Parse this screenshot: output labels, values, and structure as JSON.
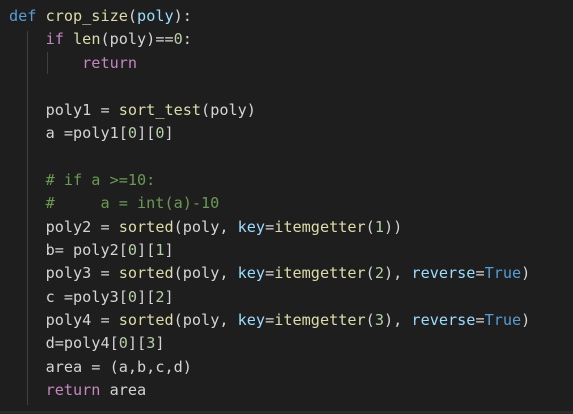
{
  "colors": {
    "background": "#1e1e1e",
    "default_text": "#d4d4d4",
    "keyword": "#569cd6",
    "control_keyword": "#c586c0",
    "function": "#dcdcaa",
    "parameter": "#9cdcfe",
    "number": "#b5cea8",
    "comment": "#6a9955"
  },
  "code": {
    "lines": [
      [
        {
          "t": "def",
          "c": "kw"
        },
        {
          "t": " ",
          "c": "plain"
        },
        {
          "t": "crop_size",
          "c": "fn"
        },
        {
          "t": "(",
          "c": "plain"
        },
        {
          "t": "poly",
          "c": "var"
        },
        {
          "t": "):",
          "c": "plain"
        }
      ],
      [
        {
          "t": "    ",
          "c": "plain"
        },
        {
          "t": "if",
          "c": "ctrl"
        },
        {
          "t": " ",
          "c": "plain"
        },
        {
          "t": "len",
          "c": "fn"
        },
        {
          "t": "(poly)",
          "c": "plain"
        },
        {
          "t": "==",
          "c": "op"
        },
        {
          "t": "0",
          "c": "num"
        },
        {
          "t": ":",
          "c": "plain"
        }
      ],
      [
        {
          "t": "        ",
          "c": "plain"
        },
        {
          "t": "return",
          "c": "ctrl"
        }
      ],
      [],
      [
        {
          "t": "    poly1 ",
          "c": "plain"
        },
        {
          "t": "=",
          "c": "op"
        },
        {
          "t": " ",
          "c": "plain"
        },
        {
          "t": "sort_test",
          "c": "fn"
        },
        {
          "t": "(poly)",
          "c": "plain"
        }
      ],
      [
        {
          "t": "    a ",
          "c": "plain"
        },
        {
          "t": "=",
          "c": "op"
        },
        {
          "t": "poly1[",
          "c": "plain"
        },
        {
          "t": "0",
          "c": "num"
        },
        {
          "t": "][",
          "c": "plain"
        },
        {
          "t": "0",
          "c": "num"
        },
        {
          "t": "]",
          "c": "plain"
        }
      ],
      [],
      [
        {
          "t": "    ",
          "c": "plain"
        },
        {
          "t": "# if a >=10:",
          "c": "comment"
        }
      ],
      [
        {
          "t": "    ",
          "c": "plain"
        },
        {
          "t": "#     a = int(a)-10",
          "c": "comment"
        }
      ],
      [
        {
          "t": "    poly2 ",
          "c": "plain"
        },
        {
          "t": "=",
          "c": "op"
        },
        {
          "t": " ",
          "c": "plain"
        },
        {
          "t": "sorted",
          "c": "fn"
        },
        {
          "t": "(poly, ",
          "c": "plain"
        },
        {
          "t": "key",
          "c": "var"
        },
        {
          "t": "=",
          "c": "op"
        },
        {
          "t": "itemgetter",
          "c": "fn"
        },
        {
          "t": "(",
          "c": "plain"
        },
        {
          "t": "1",
          "c": "num"
        },
        {
          "t": "))",
          "c": "plain"
        }
      ],
      [
        {
          "t": "    b",
          "c": "plain"
        },
        {
          "t": "=",
          "c": "op"
        },
        {
          "t": " poly2[",
          "c": "plain"
        },
        {
          "t": "0",
          "c": "num"
        },
        {
          "t": "][",
          "c": "plain"
        },
        {
          "t": "1",
          "c": "num"
        },
        {
          "t": "]",
          "c": "plain"
        }
      ],
      [
        {
          "t": "    poly3 ",
          "c": "plain"
        },
        {
          "t": "=",
          "c": "op"
        },
        {
          "t": " ",
          "c": "plain"
        },
        {
          "t": "sorted",
          "c": "fn"
        },
        {
          "t": "(poly, ",
          "c": "plain"
        },
        {
          "t": "key",
          "c": "var"
        },
        {
          "t": "=",
          "c": "op"
        },
        {
          "t": "itemgetter",
          "c": "fn"
        },
        {
          "t": "(",
          "c": "plain"
        },
        {
          "t": "2",
          "c": "num"
        },
        {
          "t": "), ",
          "c": "plain"
        },
        {
          "t": "reverse",
          "c": "var"
        },
        {
          "t": "=",
          "c": "op"
        },
        {
          "t": "True",
          "c": "kw"
        },
        {
          "t": ")",
          "c": "plain"
        }
      ],
      [
        {
          "t": "    c ",
          "c": "plain"
        },
        {
          "t": "=",
          "c": "op"
        },
        {
          "t": "poly3[",
          "c": "plain"
        },
        {
          "t": "0",
          "c": "num"
        },
        {
          "t": "][",
          "c": "plain"
        },
        {
          "t": "2",
          "c": "num"
        },
        {
          "t": "]",
          "c": "plain"
        }
      ],
      [
        {
          "t": "    poly4 ",
          "c": "plain"
        },
        {
          "t": "=",
          "c": "op"
        },
        {
          "t": " ",
          "c": "plain"
        },
        {
          "t": "sorted",
          "c": "fn"
        },
        {
          "t": "(poly, ",
          "c": "plain"
        },
        {
          "t": "key",
          "c": "var"
        },
        {
          "t": "=",
          "c": "op"
        },
        {
          "t": "itemgetter",
          "c": "fn"
        },
        {
          "t": "(",
          "c": "plain"
        },
        {
          "t": "3",
          "c": "num"
        },
        {
          "t": "), ",
          "c": "plain"
        },
        {
          "t": "reverse",
          "c": "var"
        },
        {
          "t": "=",
          "c": "op"
        },
        {
          "t": "True",
          "c": "kw"
        },
        {
          "t": ")",
          "c": "plain"
        }
      ],
      [
        {
          "t": "    d",
          "c": "plain"
        },
        {
          "t": "=",
          "c": "op"
        },
        {
          "t": "poly4[",
          "c": "plain"
        },
        {
          "t": "0",
          "c": "num"
        },
        {
          "t": "][",
          "c": "plain"
        },
        {
          "t": "3",
          "c": "num"
        },
        {
          "t": "]",
          "c": "plain"
        }
      ],
      [
        {
          "t": "    area ",
          "c": "plain"
        },
        {
          "t": "=",
          "c": "op"
        },
        {
          "t": " (a,b,c,d)",
          "c": "plain"
        }
      ],
      [
        {
          "t": "    ",
          "c": "plain"
        },
        {
          "t": "return",
          "c": "ctrl"
        },
        {
          "t": " area",
          "c": "plain"
        }
      ]
    ]
  }
}
